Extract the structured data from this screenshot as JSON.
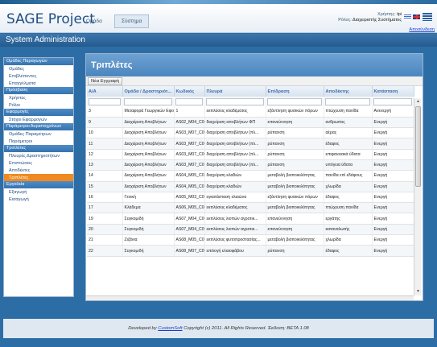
{
  "header": {
    "app_title": "SAGE Project",
    "nav": [
      {
        "label": "Ομάδα"
      },
      {
        "label": "Σύστημα"
      }
    ],
    "user_label": "Χρήστης:",
    "user_value": "tpi",
    "role_label": "Ρόλος:",
    "role_value": "Διαχειριστής Συστήματος",
    "logout": "Αποσύνδεση"
  },
  "system_bar": "System Administration",
  "sidebar": {
    "groups": [
      {
        "title": "Ομάδες Παραγωγών",
        "items": [
          "Ομάδες",
          "Επιβλέποντες",
          "Επαγγέλματα"
        ]
      },
      {
        "title": "Πρόσβαση",
        "items": [
          "Χρήστες",
          "Ρόλοι"
        ]
      },
      {
        "title": "Εφαρμογές",
        "items": [
          "Στόχοι Εφαρμογών"
        ]
      },
      {
        "title": "Παράμετροι Αυριστοχρόνων",
        "items": [
          "Ομάδες Παραμέτρων",
          "Παράμετροι"
        ]
      },
      {
        "title": "Τριπλέτες",
        "items": [
          "Πλευρές Δραστηριοτήτων",
          "Επιπτώσεις",
          "Αποδέκτες",
          "Τριπλέτες"
        ]
      },
      {
        "title": "Εργαλεία",
        "items": [
          "Εξαγωγή",
          "Εισαγωγή"
        ]
      }
    ],
    "active_item": "Τριπλέτες"
  },
  "content": {
    "title": "Τριπλέτες",
    "new_button": "Νέα Εγγραφή",
    "columns": [
      "Α/Α",
      "Ομάδα / Δραστηριότ...",
      "Κωδικός",
      "Πλευρά",
      "Επίδραση",
      "Αποδέκτης",
      "Κατάσταση"
    ],
    "rows": [
      [
        "3",
        "Μεταφορά Γεωργικών Εφο...",
        "1",
        "εκπλύσεις κλαδέματος",
        "εξάντληση φυσικών πόρων",
        "πτώχευση πανίδα",
        "Ανενεργή"
      ],
      [
        "9",
        "Διαχείριση Αποβλήτων",
        "AS02_M04_C002",
        "διαχείριση αποβλήτων ΦΠ",
        "επανεύννηση",
        "ανθρωπος",
        "Ενεργή"
      ],
      [
        "10",
        "Διαχείριση Αποβλήτων",
        "AS03_M07_C001",
        "διαχείριση αποβλήτων (πλ...",
        "ρύπανση",
        "αέρας",
        "Ενεργή"
      ],
      [
        "11",
        "Διαχείριση Αποβλήτων",
        "AS03_M07_C003",
        "διαχείριση αποβλήτων (πλ...",
        "ρύπανση",
        "έδαφος",
        "Ενεργή"
      ],
      [
        "12",
        "Διαχείριση Αποβλήτων",
        "AS03_M07_C004",
        "διαχείριση αποβλήτων (πλ...",
        "ρύπανση",
        "επιφανειακά ύδατα",
        "Ενεργή"
      ],
      [
        "13",
        "Διαχείριση Αποβλήτων",
        "AS03_M07_C014",
        "διαχείριση αποβλήτων (πλ...",
        "ρύπανση",
        "υπόγεια ύδατα",
        "Ενεργή"
      ],
      [
        "14",
        "Διαχείριση Αποβλήτων",
        "AS04_M05_C011",
        "διαχείριση κλαδιών",
        "μεταβολή βιοποικιλότητας",
        "πανίδα επί εδάφους",
        "Ενεργή"
      ],
      [
        "15",
        "Διαχείριση Αποβλήτων",
        "AS04_M05_C015",
        "διαχείριση κλαδιών",
        "μεταβολή βιοποικιλότητας",
        "χλωρίδα",
        "Ενεργή"
      ],
      [
        "16",
        "Γενική",
        "AS05_M03_C008",
        "εγκατάσταση ελαιώνα",
        "εξάντληση φυσικών πόρων",
        "έδαφος",
        "Ενεργή"
      ],
      [
        "17",
        "Κλάδεμα",
        "AS06_M05_C006",
        "εκπλύσεις κλαδέματος",
        "μεταβολή βιοποικιλότητας",
        "πτώχευση πανίδα",
        "Ενεργή"
      ],
      [
        "19",
        "Συγκομιδή",
        "AS07_M04_C005",
        "εκπλύσεις λιοπών αγροτικ...",
        "επανεύννηση",
        "εργάτης",
        "Ενεργή"
      ],
      [
        "20",
        "Συγκομιδή",
        "AS07_M04_C008",
        "εκπλύσεις λιοπών αγροτικ...",
        "επανεύννηση",
        "καταναλωτής",
        "Ενεργή"
      ],
      [
        "21",
        "Ζιζάνια",
        "AS08_M05_C015",
        "εκπλύσεις φυτοπροστασίας...",
        "μεταβολή βιοποικιλότητας",
        "χλωρίδα",
        "Ενεργή"
      ],
      [
        "22",
        "Συγκομιδή",
        "AS08_M07_C003",
        "επιλογή ελαιοφάβου",
        "ρύπανση",
        "έδαφος",
        "Ενεργή"
      ]
    ]
  },
  "footer": {
    "prefix": "Developed by",
    "link": "CustomSoft",
    "suffix": "Copyright (c) 2011. All Rights Reserved. Έκδοση: BETA 1.08"
  }
}
